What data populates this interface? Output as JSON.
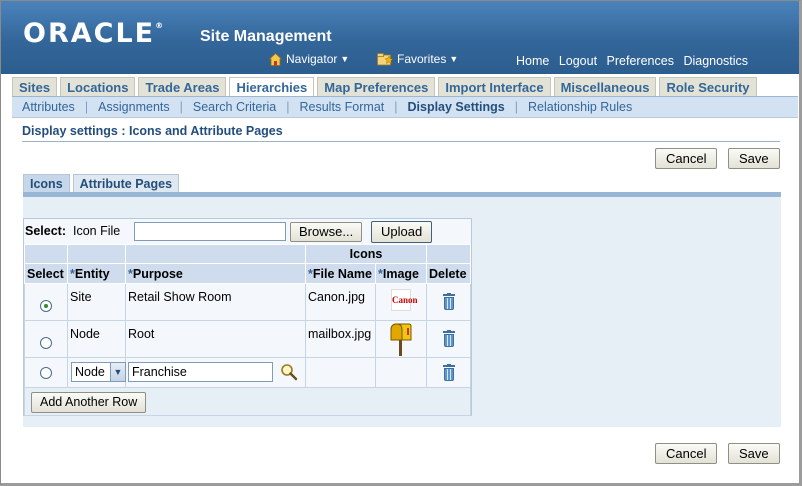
{
  "header": {
    "logo": "ORACLE",
    "logo_mark": "®",
    "app_title": "Site Management",
    "navigator": "Navigator",
    "favorites": "Favorites",
    "global_links": [
      "Home",
      "Logout",
      "Preferences",
      "Diagnostics"
    ]
  },
  "tabs": [
    "Sites",
    "Locations",
    "Trade Areas",
    "Hierarchies",
    "Map Preferences",
    "Import Interface",
    "Miscellaneous",
    "Role Security"
  ],
  "subnav": [
    "Attributes",
    "Assignments",
    "Search Criteria",
    "Results Format",
    "Display Settings",
    "Relationship Rules"
  ],
  "page": {
    "title": "Display settings : Icons and Attribute Pages",
    "cancel": "Cancel",
    "save": "Save"
  },
  "subtabs": [
    "Icons",
    "Attribute Pages"
  ],
  "upload": {
    "select_label": "Select:",
    "icon_file_label": "Icon File",
    "file_value": "",
    "browse": "Browse...",
    "upload": "Upload"
  },
  "table": {
    "group_header": "Icons",
    "headers": {
      "select": "Select",
      "entity": "Entity",
      "purpose": "Purpose",
      "file_name": "File Name",
      "image": "Image",
      "delete": "Delete",
      "required_mark": "*"
    },
    "rows": [
      {
        "entity": "Site",
        "purpose": "Retail Show Room",
        "file_name": "Canon.jpg",
        "image_text": "Canon"
      },
      {
        "entity": "Node",
        "purpose": "Root",
        "file_name": "mailbox.jpg"
      }
    ],
    "new_row": {
      "entity_select": "Node",
      "purpose_value": "Franchise"
    },
    "add_row": "Add Another Row"
  },
  "colors": {
    "header_blue": "#336699",
    "tab_bg": "#e2e2d6",
    "table_header": "#cfdced"
  },
  "icons": [
    "home-icon",
    "favorites-folder-icon",
    "search-icon",
    "trash-icon",
    "mailbox-icon"
  ]
}
